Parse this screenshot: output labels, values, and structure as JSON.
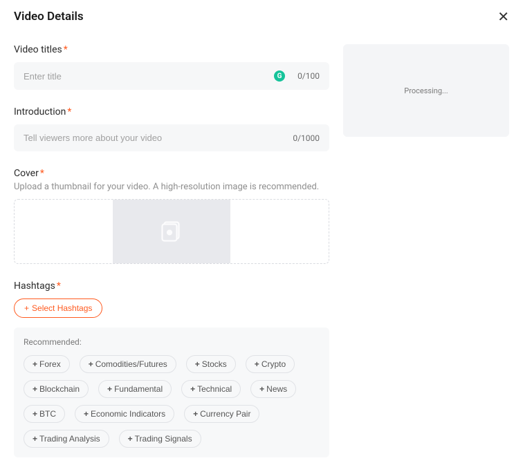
{
  "header": {
    "title": "Video Details"
  },
  "titleField": {
    "label": "Video titles",
    "placeholder": "Enter title",
    "value": "",
    "counter": "0/100"
  },
  "introField": {
    "label": "Introduction",
    "placeholder": "Tell viewers more about your video",
    "value": "",
    "counter": "0/1000"
  },
  "coverField": {
    "label": "Cover",
    "help": "Upload a thumbnail for your video. A high-resolution image is recommended."
  },
  "hashtagsField": {
    "label": "Hashtags",
    "selectButton": "Select Hashtags",
    "recommendedLabel": "Recommended:",
    "recommended": [
      "Forex",
      "Comodities/Futures",
      "Stocks",
      "Crypto",
      "Blockchain",
      "Fundamental",
      "Technical",
      "News",
      "BTC",
      "Economic Indicators",
      "Currency Pair",
      "Trading Analysis",
      "Trading Signals"
    ]
  },
  "preview": {
    "status": "Processing..."
  }
}
